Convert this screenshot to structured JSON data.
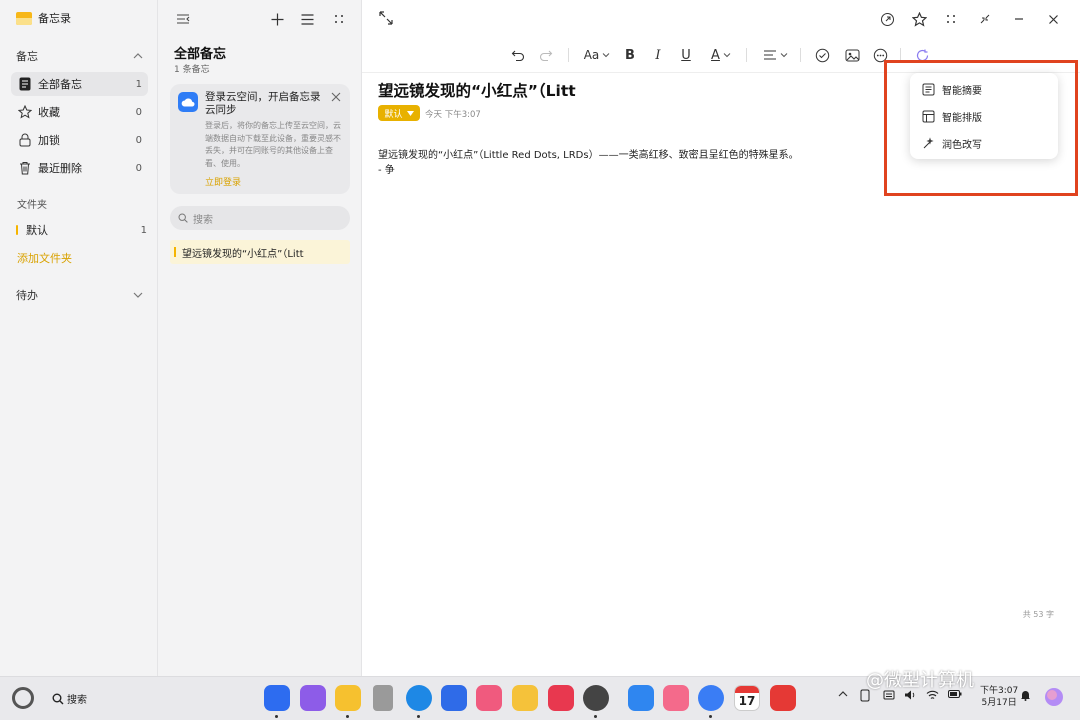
{
  "app": {
    "title": "备忘录"
  },
  "sidebar": {
    "section_memo": "备忘",
    "items": [
      {
        "label": "全部备忘",
        "count": "1"
      },
      {
        "label": "收藏",
        "count": "0"
      },
      {
        "label": "加锁",
        "count": "0"
      },
      {
        "label": "最近删除",
        "count": "0"
      }
    ],
    "folder_label": "文件夹",
    "folders": [
      {
        "label": "默认",
        "count": "1"
      }
    ],
    "add_folder": "添加文件夹",
    "section_todo": "待办"
  },
  "list": {
    "title": "全部备忘",
    "subtitle": "1 条备忘",
    "cloud_card": {
      "title": "登录云空间，开启备忘录云同步",
      "description": "登录后，将你的备忘上传至云空间，云端数据自动下载至此设备，重要灵感不丢失，并可在同账号的其他设备上查看、使用。",
      "action": "立即登录"
    },
    "search_placeholder": "搜索",
    "notes": [
      {
        "title": "望远镜发现的“小红点”（Litt"
      }
    ]
  },
  "editor": {
    "note_title": "望远镜发现的“小红点”（Litt",
    "tag": "默认",
    "timestamp": "今天 下午3:07",
    "body_lines": [
      "望远镜发现的“小红点”（Little Red Dots, LRDs）——一类高红移、致密且呈红色的特殊星系。",
      "- 争"
    ],
    "word_count": "共 53 字",
    "format_font_label": "Aa",
    "format_bold": "B",
    "format_italic": "I",
    "format_underline": "U",
    "format_color": "A",
    "ai_menu": [
      {
        "label": "智能摘要",
        "icon": "summary-icon"
      },
      {
        "label": "智能排版",
        "icon": "layout-icon"
      },
      {
        "label": "润色改写",
        "icon": "magic-wand-icon"
      }
    ]
  },
  "taskbar": {
    "search_label": "搜索",
    "calendar_day": "17",
    "clock_time": "下午3:07",
    "clock_date": "5月17日",
    "dock_apps": [
      "app-grid",
      "files",
      "notes",
      "trash",
      "browser",
      "mail",
      "gallery",
      "cards",
      "app-gallery",
      "settings",
      "docs",
      "photo-editor",
      "music",
      "calendar",
      "wps-office"
    ],
    "dock_colors": [
      "#2d6cf0",
      "#8d5ce8",
      "#f6c12f",
      "#9a9a9a",
      "#1e88e5",
      "#2f6be8",
      "#f05a7e",
      "#f5c23a",
      "#e8384f",
      "#444444",
      "#2f86f0",
      "#f46a8b",
      "#3a7df5",
      "#ffffff",
      "#e53935"
    ]
  },
  "watermark": "@微型计算机"
}
